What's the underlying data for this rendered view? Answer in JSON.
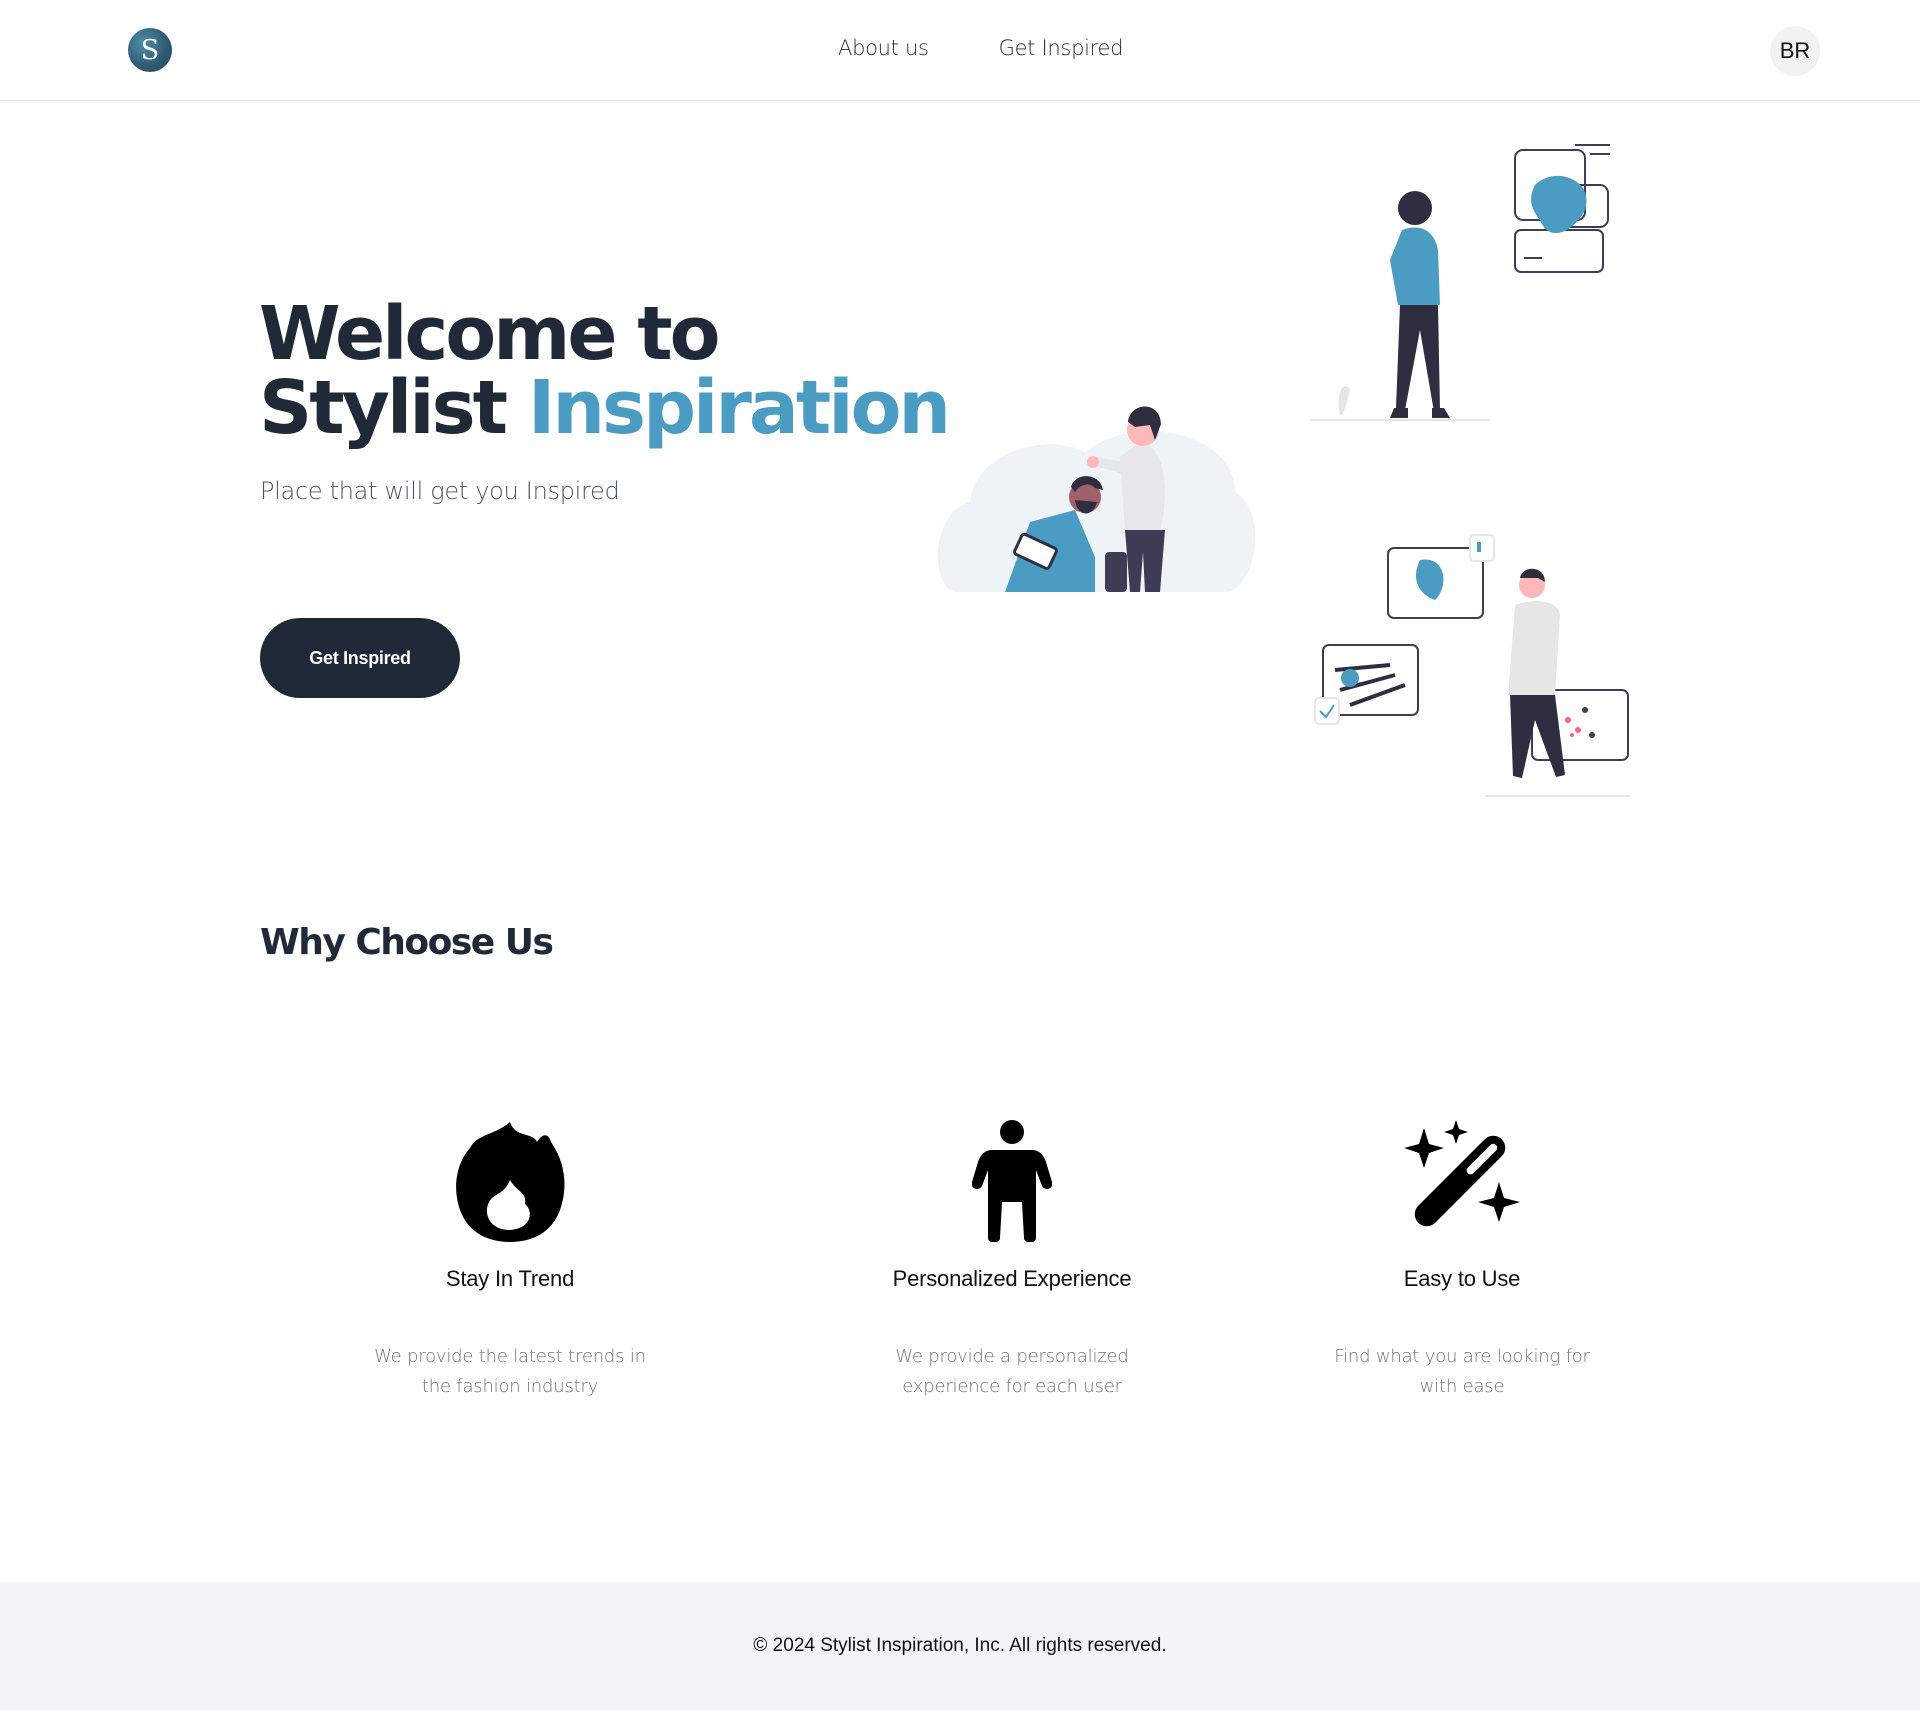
{
  "header": {
    "logo_letter": "S",
    "nav": [
      "About us",
      "Get Inspired"
    ],
    "avatar_initials": "BR"
  },
  "hero": {
    "title_line1": "Welcome to",
    "title_line2_prefix": "Stylist ",
    "title_line2_accent": "Inspiration",
    "subtitle": "Place that will get you Inspired",
    "cta_label": "Get Inspired"
  },
  "why": {
    "title": "Why Choose Us",
    "features": [
      {
        "icon": "flame-icon",
        "title": "Stay In Trend",
        "description": "We provide the latest trends in the fashion industry"
      },
      {
        "icon": "person-icon",
        "title": "Personalized Experience",
        "description": "We provide a personalized experience for each user"
      },
      {
        "icon": "magic-wand-icon",
        "title": "Easy to Use",
        "description": "Find what you are looking for with ease"
      }
    ]
  },
  "footer": {
    "copyright": "© 2024 Stylist Inspiration, Inc. All rights reserved."
  },
  "colors": {
    "accent": "#4a9cc2",
    "dark": "#1f2937",
    "footer_bg": "#f3f4f6"
  }
}
